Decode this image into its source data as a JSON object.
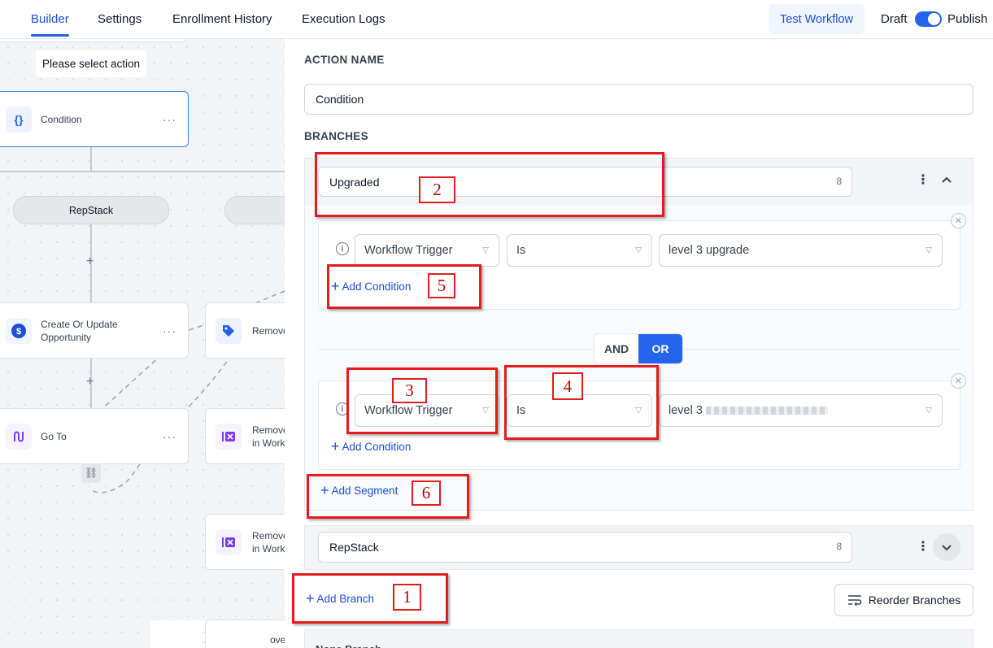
{
  "nav": {
    "tabs": [
      "Builder",
      "Settings",
      "Enrollment History",
      "Execution Logs"
    ],
    "test_button": "Test Workflow",
    "draft_label": "Draft",
    "publish_label": "Publish"
  },
  "canvas": {
    "placeholder_label": "Please select action",
    "nodes": {
      "condition": "Condition",
      "opportunity_line1": "Create Or Update",
      "opportunity_line2": "Opportunity",
      "goto": "Go To",
      "remove_tag": "Remove",
      "remove_workflow_1_line1": "Remove",
      "remove_workflow_1_line2": "in Work",
      "remove_workflow_2_line1": "Remove",
      "remove_workflow_2_line2": "in Work",
      "remove_bottom": "ove"
    },
    "branch_pill": "RepStack"
  },
  "panel": {
    "action_name_title": "ACTION NAME",
    "action_name_value": "Condition",
    "branches_title": "BRANCHES",
    "branch1": {
      "name": "Upgraded",
      "count": "8",
      "segment1": {
        "field": "Workflow Trigger",
        "operator": "Is",
        "value": "level 3 upgrade"
      },
      "segment2": {
        "field": "Workflow Trigger",
        "operator": "Is",
        "value_prefix": "level 3"
      },
      "add_condition": "Add Condition",
      "add_segment": "Add Segment",
      "and_label": "AND",
      "or_label": "OR"
    },
    "branch2": {
      "name": "RepStack",
      "count": "8"
    },
    "add_branch": "Add Branch",
    "reorder_branches": "Reorder Branches",
    "none_branch": "None Branch"
  },
  "annotations": [
    "1",
    "2",
    "3",
    "4",
    "5",
    "6"
  ],
  "colors": {
    "accent": "#2563eb",
    "annotation_red": "#e11d1d"
  }
}
